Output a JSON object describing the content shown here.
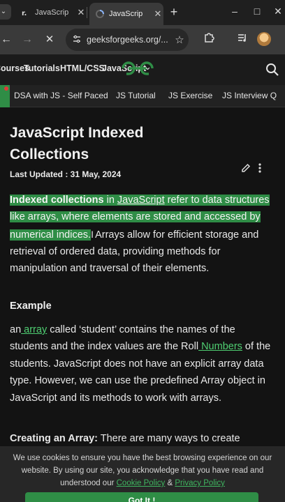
{
  "browser": {
    "tabs": [
      {
        "title": "JavaScrip",
        "active": false
      },
      {
        "title": "JavaScrip",
        "active": true
      }
    ],
    "new_tab": "+",
    "url": "geeksforgeeks.org/...",
    "window_controls": {
      "minimize": "–",
      "maximize": "□",
      "close": "✕"
    }
  },
  "site": {
    "nav": {
      "courses": "Courses",
      "tutorials": "Tutorials",
      "html_css": "HTML/CSS",
      "javascript": "JavaScript"
    },
    "logo": "GfG",
    "subnav": [
      "DSA with JS - Self Paced",
      "JS Tutorial",
      "JS Exercise",
      "JS Interview Q"
    ]
  },
  "article": {
    "title": "JavaScript Indexed Collections",
    "last_updated": "Last Updated : 31 May, 2024",
    "intro": {
      "bold": "Indexed collections",
      "in": " in ",
      "link": "JavaScript",
      "rest_hl": " refer to data structures like arrays, where elements are stored and accessed by numerical indices.",
      "rest": "Arrays allow for efficient storage and retrieval of ordered data, providing methods for manipulation and traversal of their elements."
    },
    "example_heading": "Example",
    "example": {
      "pre": "an",
      "link1": " array",
      "mid": " called ‘student’ contains the names of the students and the index values are the Roll",
      "link2": " Numbers",
      "post": " of the students. JavaScript does not have an explicit array data type. However, we can use the predefined Array object in JavaScript and its methods to work with arrays."
    },
    "creating": {
      "bold": "Creating an Array:",
      "rest": " There are many ways to create"
    }
  },
  "cookie": {
    "text": "We use cookies to ensure you have the best browsing experience on our website. By using our site, you acknowledge that you have read and understood our ",
    "policy": "Cookie Policy",
    "and": " & ",
    "privacy": "Privacy Policy",
    "button": "Got It !"
  },
  "colors": {
    "accent": "#2f8d46",
    "link": "#4fcf72",
    "background": "#131313"
  }
}
